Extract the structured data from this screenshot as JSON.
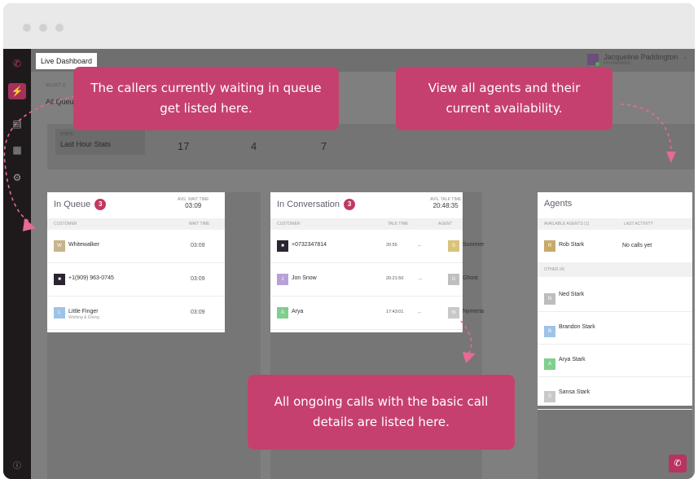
{
  "window": {
    "dots": [
      "close",
      "minimize",
      "maximize"
    ]
  },
  "sidebar": {
    "items": [
      {
        "icon": "phone-icon"
      },
      {
        "icon": "lightning-icon",
        "active": true
      },
      {
        "icon": "chart-icon"
      },
      {
        "icon": "card-icon"
      },
      {
        "icon": "gear-icon"
      },
      {
        "icon": "help-icon"
      }
    ]
  },
  "topbar": {
    "tab_label": "Live Dashboard",
    "user_name": "Jacqueline Paddington",
    "user_status": "ON BREAKER"
  },
  "filters": {
    "select_label": "SELECT Q",
    "select_value": "All Queu"
  },
  "stats": {
    "period_label": "STATS",
    "period_value": "Last Hour Stats",
    "values": [
      "17",
      "4",
      "7"
    ]
  },
  "queue": {
    "title": "In Queue",
    "count": "3",
    "avg_label": "AVG. WAIT TIME",
    "avg_value": "03:09",
    "col_customer": "CUSTOMER",
    "col_wait": "WAIT TIME",
    "rows": [
      {
        "initial": "W",
        "name": "Whitewalker",
        "sub": "",
        "wait": "03:09",
        "color": "#c8b38a"
      },
      {
        "initial": "",
        "name": "+1(909) 963-0745",
        "sub": "",
        "wait": "03:09",
        "color": "#2a2530"
      },
      {
        "initial": "L",
        "name": "Little Finger",
        "sub": "Wishing & Dining",
        "wait": "03:09",
        "color": "#9ec3e6"
      }
    ]
  },
  "conversation": {
    "title": "In Conversation",
    "count": "3",
    "avg_label": "AVG. TALK TIME",
    "avg_value": "20:48:35",
    "col_customer": "CUSTOMER",
    "col_talk": "TALK TIME",
    "col_agent": "AGENT",
    "rows": [
      {
        "initial": "",
        "name": "+0732347814",
        "talk": "20:55",
        "arrow": "←",
        "agent_initial": "S",
        "agent": "Summer",
        "color": "#2a2530",
        "agent_color": "#d9c27a"
      },
      {
        "initial": "J",
        "name": "Jon Snow",
        "talk": "20:21:50",
        "arrow": "→",
        "agent_initial": "G",
        "agent": "Ghost",
        "color": "#b6a1d6",
        "agent_color": "#bfbfbf"
      },
      {
        "initial": "A",
        "name": "Arya",
        "talk": "17:43:01",
        "arrow": "←",
        "agent_initial": "N",
        "agent": "Nymeria",
        "color": "#7ed08c",
        "agent_color": "#c9c9c9"
      }
    ]
  },
  "agents": {
    "title": "Agents",
    "col_available": "AVAILABLE AGENTS (1)",
    "col_last": "LAST ACTIVITY",
    "available": [
      {
        "initial": "R",
        "name": "Rob Stark",
        "last": "No calls yet",
        "color": "#c8a96a"
      }
    ],
    "other_label": "OTHER (4)",
    "other": [
      {
        "initial": "N",
        "name": "Ned Stark",
        "color": "#bdbdbd"
      },
      {
        "initial": "B",
        "name": "Brandon Stark",
        "color": "#9ec3e6"
      },
      {
        "initial": "A",
        "name": "Arya Stark",
        "color": "#7ed08c"
      },
      {
        "initial": "S",
        "name": "Sansa Stark",
        "color": "#c9c9c9"
      }
    ]
  },
  "callouts": {
    "queue": "The callers currently waiting in queue get listed here.",
    "agents": "View all agents and their current availability.",
    "calls": "All ongoing calls with the basic call details are listed here."
  },
  "colors": {
    "accent": "#c6406f",
    "badge": "#c2385f",
    "sidebar": "#1e1a1b"
  }
}
